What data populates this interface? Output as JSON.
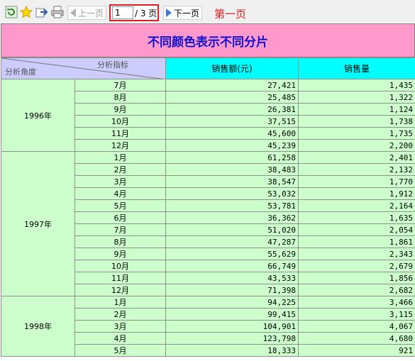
{
  "toolbar": {
    "icons": [
      "refresh-icon",
      "favorite-star-icon",
      "export-icon",
      "print-icon"
    ],
    "prev_label": "上一页",
    "next_label": "下一页",
    "current_page": "1",
    "total_pages_text": "/ 3 页",
    "page_note": "第一页"
  },
  "report": {
    "title": "不同颜色表示不同分片",
    "corner_top": "分析指标",
    "corner_bottom": "分析角度",
    "col_sales_amount": "销售额(元)",
    "col_sales_volume": "销售量",
    "colors": {
      "title_bg": "#ff99cc",
      "title_text": "#1010d0",
      "corner_bg": "#ccccff",
      "header_bg": "#00ffff",
      "body_bg": "#ccffcc",
      "page_highlight": "#e02020"
    },
    "groups": [
      {
        "year": "1996年",
        "rows": [
          {
            "month": "7月",
            "amount": "27,421",
            "volume": "1,435"
          },
          {
            "month": "8月",
            "amount": "25,485",
            "volume": "1,322"
          },
          {
            "month": "9月",
            "amount": "26,381",
            "volume": "1,124"
          },
          {
            "month": "10月",
            "amount": "37,515",
            "volume": "1,738"
          },
          {
            "month": "11月",
            "amount": "45,600",
            "volume": "1,735"
          },
          {
            "month": "12月",
            "amount": "45,239",
            "volume": "2,200"
          }
        ]
      },
      {
        "year": "1997年",
        "rows": [
          {
            "month": "1月",
            "amount": "61,258",
            "volume": "2,401"
          },
          {
            "month": "2月",
            "amount": "38,483",
            "volume": "2,132"
          },
          {
            "month": "3月",
            "amount": "38,547",
            "volume": "1,770"
          },
          {
            "month": "4月",
            "amount": "53,032",
            "volume": "1,912"
          },
          {
            "month": "5月",
            "amount": "53,781",
            "volume": "2,164"
          },
          {
            "month": "6月",
            "amount": "36,362",
            "volume": "1,635"
          },
          {
            "month": "7月",
            "amount": "51,020",
            "volume": "2,054"
          },
          {
            "month": "8月",
            "amount": "47,287",
            "volume": "1,861"
          },
          {
            "month": "9月",
            "amount": "55,629",
            "volume": "2,343"
          },
          {
            "month": "10月",
            "amount": "66,749",
            "volume": "2,679"
          },
          {
            "month": "11月",
            "amount": "43,533",
            "volume": "1,856"
          },
          {
            "month": "12月",
            "amount": "71,398",
            "volume": "2,682"
          }
        ]
      },
      {
        "year": "1998年",
        "rows": [
          {
            "month": "1月",
            "amount": "94,225",
            "volume": "3,466"
          },
          {
            "month": "2月",
            "amount": "99,415",
            "volume": "3,115"
          },
          {
            "month": "3月",
            "amount": "104,901",
            "volume": "4,067"
          },
          {
            "month": "4月",
            "amount": "123,798",
            "volume": "4,680"
          },
          {
            "month": "5月",
            "amount": "18,333",
            "volume": "921"
          }
        ]
      }
    ]
  }
}
